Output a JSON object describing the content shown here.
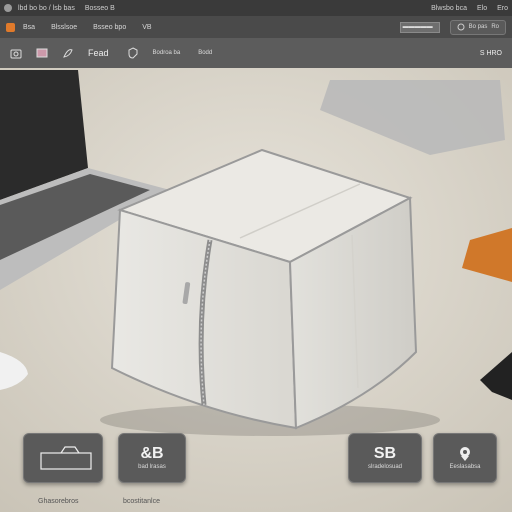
{
  "titlebar": {
    "items": [
      "lbd bo bo / lsb bas",
      "Bosseo  B"
    ],
    "right": [
      "Blwsbo bca",
      "Elo",
      "Ero"
    ]
  },
  "tabbar": {
    "items": [
      "Bsa",
      "Blsslsoe",
      "Bsseo bpo",
      "VB"
    ],
    "input_value": "▬▬▬▬▬",
    "pill_label": "Bo pas",
    "pill_right": "Ro"
  },
  "toolbar": {
    "label_main": "Fead",
    "label_small_1": "Bodroa ba",
    "label_small_2": "Bodd",
    "right_text": "S HRO"
  },
  "cards": [
    {
      "big": "",
      "cap": "",
      "caption": "Ghasorebros"
    },
    {
      "big": "&B",
      "cap": "bad lrasas",
      "caption": "bcostitanlce"
    },
    {
      "big": "SB",
      "cap": "slradelosuad",
      "caption": ""
    },
    {
      "big": "",
      "cap": "Eeslasabsa",
      "caption": ""
    }
  ],
  "colors": {
    "titlebar": "#3a3a3a",
    "tabbar": "#4a4a4a",
    "toolbar": "#5c5c5c",
    "accent": "#e07a2b"
  }
}
